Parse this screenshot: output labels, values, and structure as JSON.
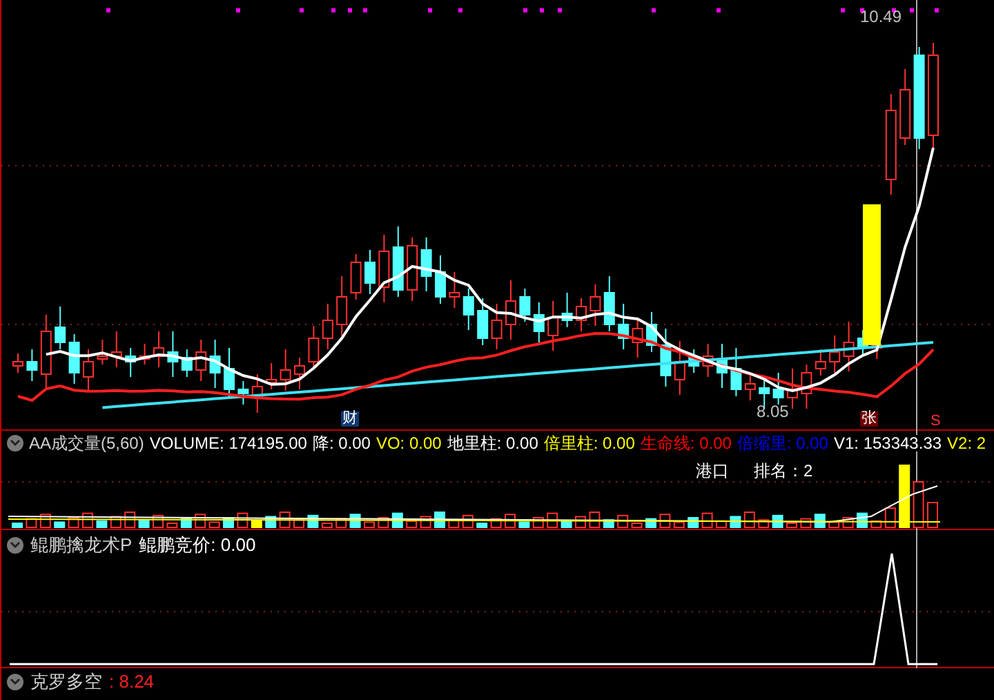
{
  "main_chart": {
    "high_label": "10.49",
    "low_label": "8.05",
    "markers": [
      {
        "text": "财",
        "kind": "finance"
      },
      {
        "text": "张",
        "kind": "limit"
      },
      {
        "text": "S",
        "kind": "signal"
      }
    ]
  },
  "volume_panel": {
    "title": "AA成交量(5,60)",
    "legend": [
      {
        "text": "VOLUME: 174195.00",
        "color": "#ffffff"
      },
      {
        "text": "降: 0.00",
        "color": "#ffffff"
      },
      {
        "text": "VO: 0.00",
        "color": "#ffff00"
      },
      {
        "text": "地里柱: 0.00",
        "color": "#ffffff"
      },
      {
        "text": "倍里柱: 0.00",
        "color": "#ffff00"
      },
      {
        "text": "生命线: 0.00",
        "color": "#ff0000"
      },
      {
        "text": "倍缩里: 0.00",
        "color": "#0000ff"
      },
      {
        "text": "V1: 153343.33",
        "color": "#ffffff"
      },
      {
        "text": "V2: 2",
        "color": "#ffff00"
      }
    ],
    "sector": "港口",
    "rank": "排名：2"
  },
  "indicator_panel": {
    "title": "鲲鹏擒龙术P",
    "value": "鲲鹏竞价: 0.00"
  },
  "bottom_panel": {
    "title": "克罗多空",
    "value": ": 8.24"
  }
}
